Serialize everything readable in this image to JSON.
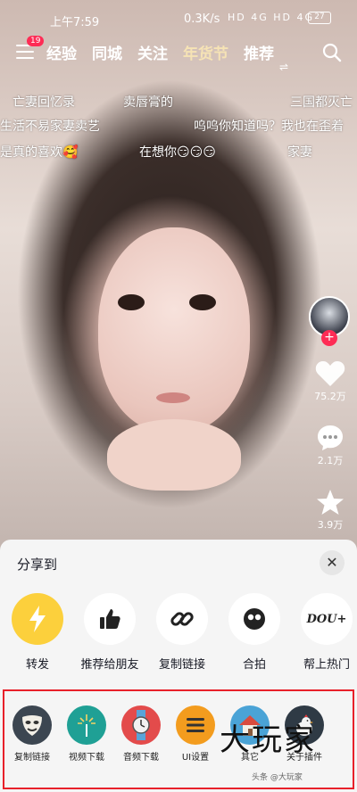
{
  "status_bar": {
    "time": "上午7:59",
    "net_speed": "0.3K/s",
    "sys_icons": "HD 4G HD 4G",
    "battery": "27"
  },
  "top_nav": {
    "menu_badge": "19",
    "tabs": [
      {
        "label": "经验"
      },
      {
        "label": "同城"
      },
      {
        "label": "关注"
      },
      {
        "label": "年货节"
      },
      {
        "label": "推荐"
      }
    ],
    "active_tab": "推荐"
  },
  "danmaku": [
    {
      "text": "亡妻回忆录"
    },
    {
      "text": "卖唇膏的"
    },
    {
      "text": "三国都灭亡"
    },
    {
      "text": "生活不易家妻卖艺"
    },
    {
      "text": "呜呜你知道吗？我也在歪着"
    },
    {
      "text": "是真的喜欢🥰"
    },
    {
      "text": "在想你😏😏😏"
    },
    {
      "text": "家妻"
    }
  ],
  "right_rail": {
    "likes": "75.2万",
    "comments": "2.1万",
    "favorites": "3.9万"
  },
  "share_sheet": {
    "title": "分享到",
    "items": [
      {
        "label": "转发",
        "icon": "lightning-icon"
      },
      {
        "label": "推荐给朋友",
        "icon": "thumbs-up-icon"
      },
      {
        "label": "复制链接",
        "icon": "link-icon"
      },
      {
        "label": "合拍",
        "icon": "duet-icon"
      },
      {
        "label": "帮上热门",
        "icon": "dou-plus-icon"
      }
    ],
    "tools": [
      {
        "label": "复制链接",
        "icon": "mask-icon"
      },
      {
        "label": "视频下载",
        "icon": "sparkle-icon"
      },
      {
        "label": "音频下载",
        "icon": "watch-icon"
      },
      {
        "label": "UI设置",
        "icon": "menu-list-icon"
      },
      {
        "label": "其它",
        "icon": "home-icon"
      },
      {
        "label": "关于插件",
        "icon": "chicken-icon"
      }
    ]
  },
  "watermark": {
    "main": "大玩家",
    "sub": "头条 @大玩家"
  }
}
